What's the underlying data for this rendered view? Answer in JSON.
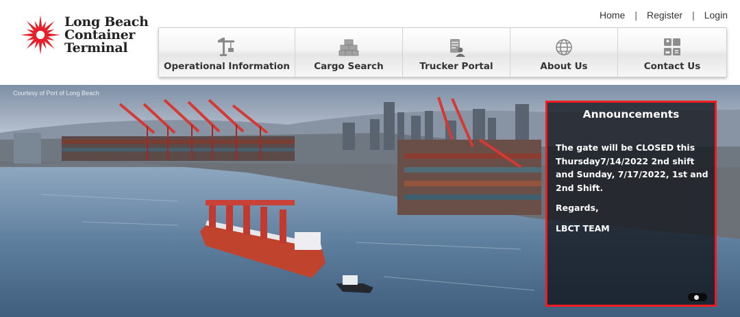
{
  "brand": {
    "name_lines": [
      "Long Beach",
      "Container",
      "Terminal"
    ],
    "accent_color": "#e4202a",
    "logo_icon": "starburst-logo-icon"
  },
  "top_links": [
    {
      "label": "Home"
    },
    {
      "label": "Register"
    },
    {
      "label": "Login"
    }
  ],
  "nav": [
    {
      "label": "Operational Information",
      "icon": "crane-icon"
    },
    {
      "label": "Cargo Search",
      "icon": "containers-icon"
    },
    {
      "label": "Trucker Portal",
      "icon": "clipboard-user-icon"
    },
    {
      "label": "About Us",
      "icon": "globe-icon"
    },
    {
      "label": "Contact Us",
      "icon": "contact-card-icon"
    }
  ],
  "hero": {
    "courtesy": "Courtesy of Port of Long Beach"
  },
  "announcements": {
    "title": "Announcements",
    "border_color": "#ee1c1c",
    "paragraphs": [
      "The gate will be CLOSED this Thursday7/14/2022 2nd shift and Sunday, 7/17/2022, 1st and 2nd Shift.",
      "Regards,",
      "LBCT TEAM"
    ]
  }
}
